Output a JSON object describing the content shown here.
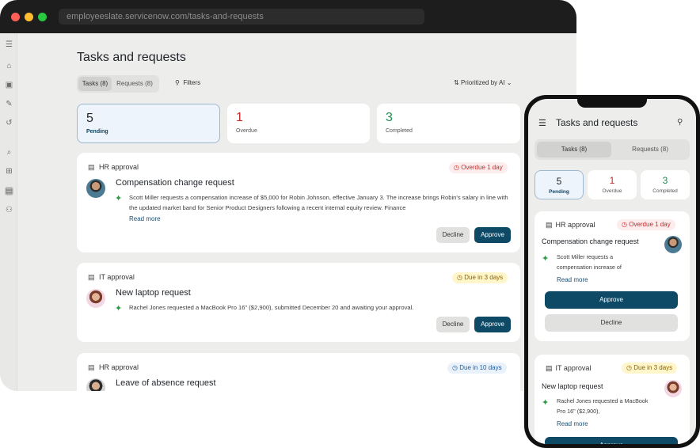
{
  "browser": {
    "url": "employeeslate.servicenow.com/tasks-and-requests"
  },
  "sidebar": {
    "icons": [
      "menu-icon",
      "home-icon",
      "id-card-icon",
      "edit-icon",
      "history-icon",
      "search-icon",
      "apps-icon",
      "inbox-icon",
      "org-chart-icon"
    ],
    "active": "inbox-icon"
  },
  "page": {
    "title": "Tasks and requests"
  },
  "tabs": {
    "tasks": "Tasks (8)",
    "requests": "Requests (8)"
  },
  "toolbar": {
    "filters": "Filters",
    "sort": "Prioritized by AI"
  },
  "stats": [
    {
      "value": "5",
      "label": "Pending",
      "color": "#1f2328"
    },
    {
      "value": "1",
      "label": "Overdue",
      "color": "#c62828"
    },
    {
      "value": "3",
      "label": "Completed",
      "color": "#1e8e4f"
    }
  ],
  "cards": [
    {
      "type": "HR approval",
      "badge": "Overdue 1 day",
      "title": "Compensation change request",
      "description": "Scott Miller requests a compensation increase of $5,000 for Robin Johnson, effective January 3. The increase brings Robin's salary in line with the updated market band for Senior Product Designers following a recent internal equity review. Finance",
      "read_more": "Read more",
      "decline": "Decline",
      "approve": "Approve"
    },
    {
      "type": "IT approval",
      "badge": "Due in 3 days",
      "title": "New laptop request",
      "description": "Rachel Jones requested a MacBook Pro 16\" ($2,900), submitted December 20 and awaiting your approval.",
      "decline": "Decline",
      "approve": "Approve"
    },
    {
      "type": "HR approval",
      "badge": "Due in 10 days",
      "title": "Leave of absence request"
    }
  ],
  "mobile": {
    "title": "Tasks and requests",
    "tabs": {
      "tasks": "Tasks (8)",
      "requests": "Requests (8)"
    },
    "stats": [
      {
        "value": "5",
        "label": "Pending"
      },
      {
        "value": "1",
        "label": "Overdue"
      },
      {
        "value": "3",
        "label": "Completed"
      }
    ],
    "cards": [
      {
        "type": "HR approval",
        "badge": "Overdue 1 day",
        "title": "Compensation change request",
        "description": "Scott Miller requests a compensation increase of",
        "read_more": "Read more",
        "approve": "Approve",
        "decline": "Decline"
      },
      {
        "type": "IT approval",
        "badge": "Due in 3 days",
        "title": "New laptop request",
        "description": "Rachel Jones requested a MacBook Pro 16\" ($2,900),",
        "read_more": "Read more",
        "approve": "Approve"
      }
    ]
  }
}
